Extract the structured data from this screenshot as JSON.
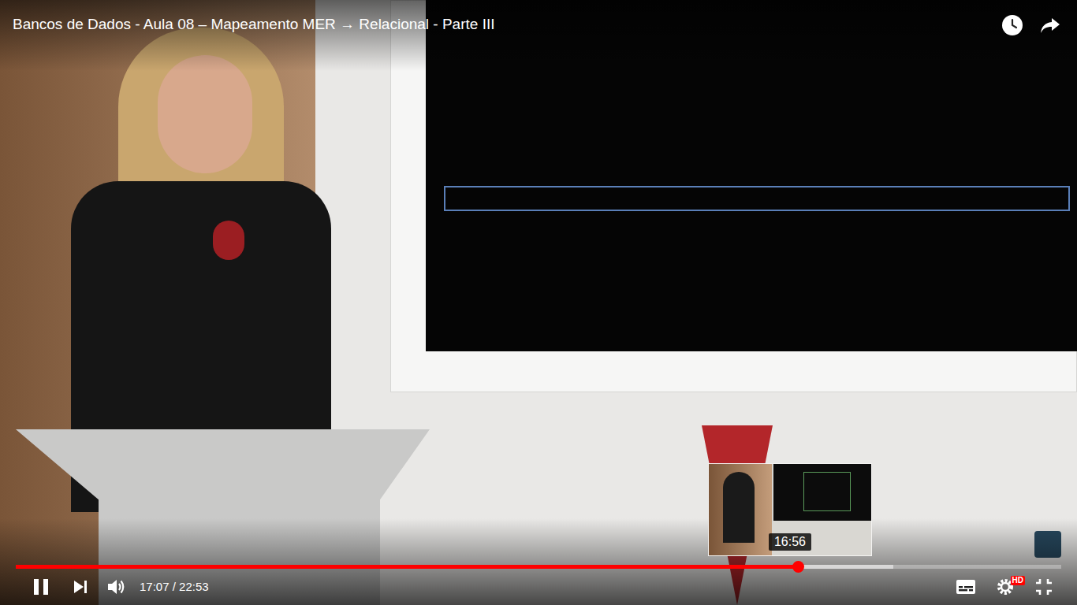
{
  "player": {
    "title": "Bancos de Dados - Aula 08 – Mapeamento MER → Relacional - Parte III",
    "state": {
      "playing": true
    },
    "time": "17:07 / 22:53",
    "progress": {
      "played": {
        "level": 0.748
      },
      "buffered": {
        "level": 0.839
      }
    },
    "preview": {
      "time": "16:56"
    },
    "quality_badge": "HD"
  }
}
